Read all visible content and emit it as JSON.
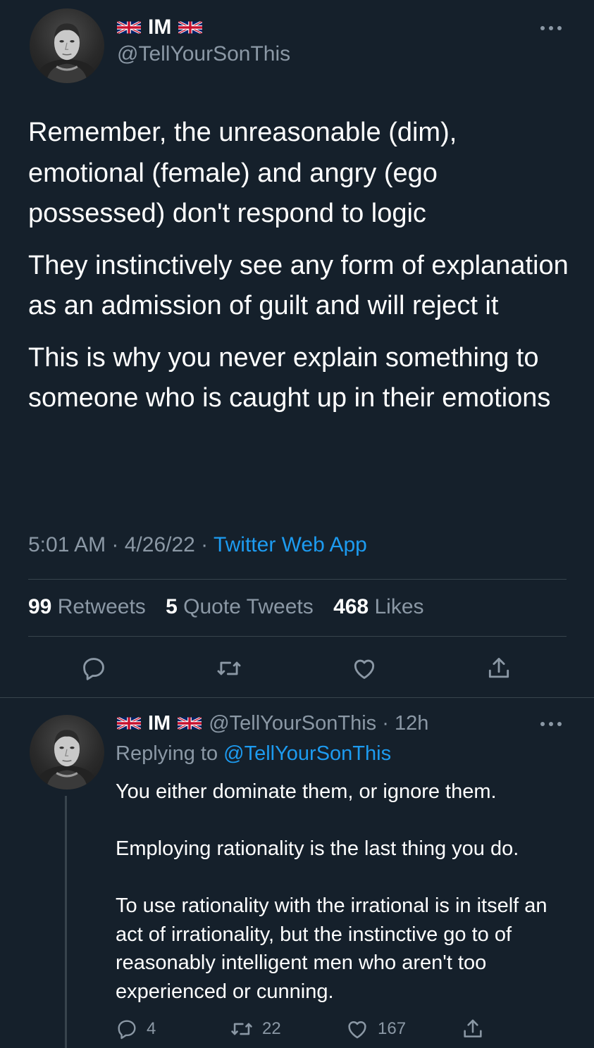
{
  "main_tweet": {
    "display_name": "IM",
    "handle": "@TellYourSonThis",
    "paragraphs": [
      "Remember, the unreasonable (dim), emotional (female) and angry (ego possessed) don't respond to logic",
      "They instinctively see any form of explanation as an admission of guilt and will reject it",
      "This is why you never explain something to someone who is caught up in their emotions"
    ],
    "time": "5:01 AM",
    "date": "4/26/22",
    "source": "Twitter Web App",
    "stats": {
      "retweets_count": "99",
      "retweets_label": "Retweets",
      "quotes_count": "5",
      "quotes_label": "Quote Tweets",
      "likes_count": "468",
      "likes_label": "Likes"
    }
  },
  "reply_tweet": {
    "display_name": "IM",
    "handle": "@TellYourSonThis",
    "age": "12h",
    "replying_prefix": "Replying to",
    "replying_to": "@TellYourSonThis",
    "paragraphs": [
      "You either dominate them, or ignore them.",
      "Employing rationality is the last thing you do.",
      "To use rationality with the irrational is in itself an act of irrationality, but the instinctive go to of reasonably intelligent men who aren't too experienced or cunning."
    ],
    "reply_count": "4",
    "retweet_count": "22",
    "like_count": "167"
  },
  "icons": {
    "flag": "union-jack-icon",
    "more": "more-icon",
    "reply": "reply-icon",
    "retweet": "retweet-icon",
    "like": "heart-icon",
    "share": "share-icon"
  },
  "colors": {
    "background": "#15202b",
    "text": "#ffffff",
    "secondary": "#8b98a5",
    "link": "#1d9bf0",
    "divider": "#38444d"
  }
}
